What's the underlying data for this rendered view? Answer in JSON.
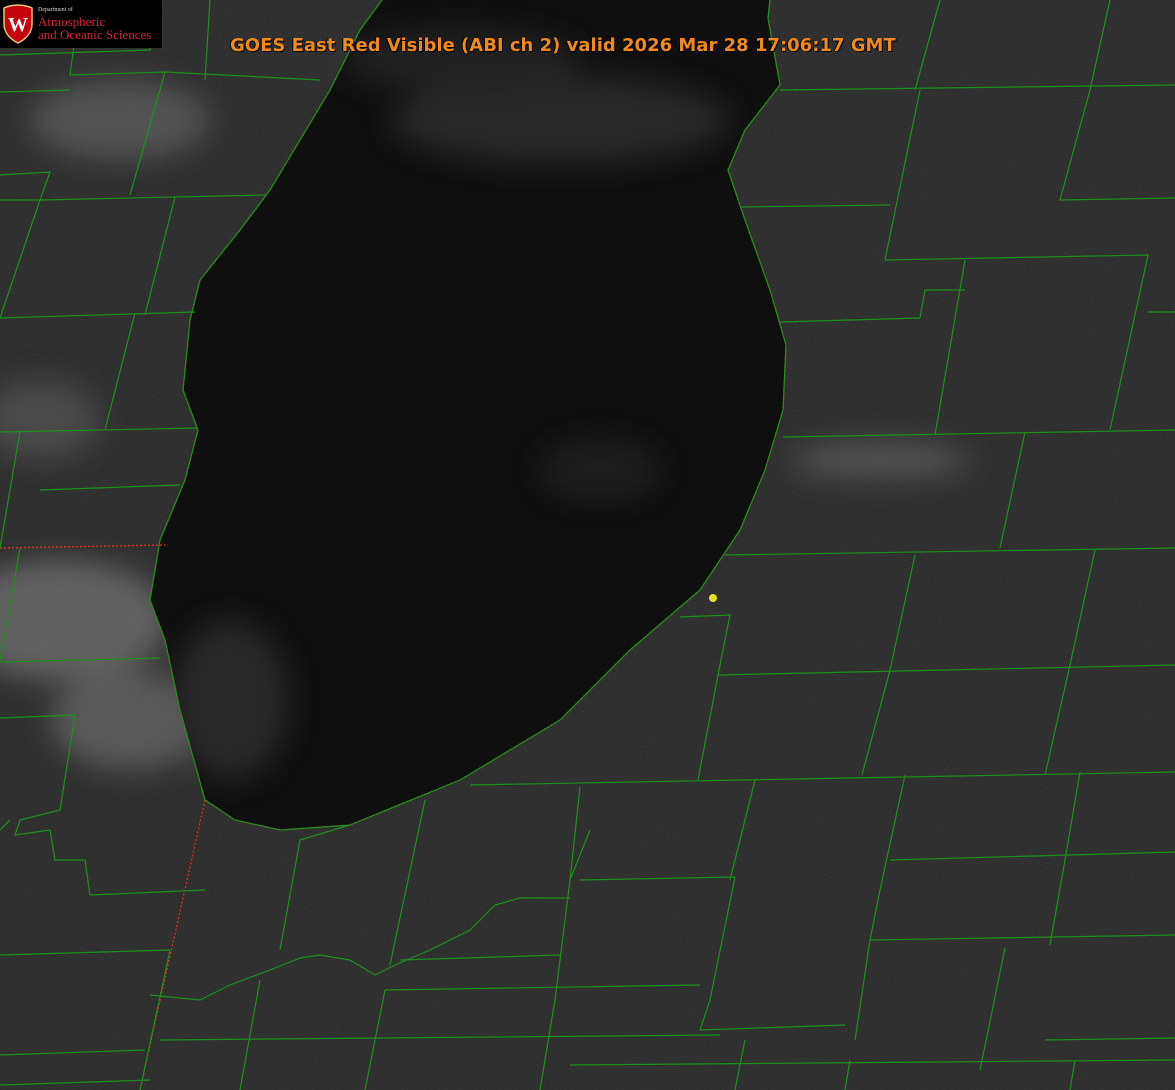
{
  "title": "GOES East Red Visible (ABI ch 2) valid 2026 Mar 28 17:06:17 GMT",
  "logo": {
    "department": "Department of",
    "line1": "Atmospheric",
    "line2": "and Oceanic Sciences",
    "crest_letter": "W",
    "crest_icon": "uw-crest-icon"
  },
  "colors": {
    "title": "#f08a1e",
    "county_lines": "#1f8f1f",
    "state_lines": "#d9361a",
    "marker": "#e6e024",
    "brand": "#c5050c"
  }
}
